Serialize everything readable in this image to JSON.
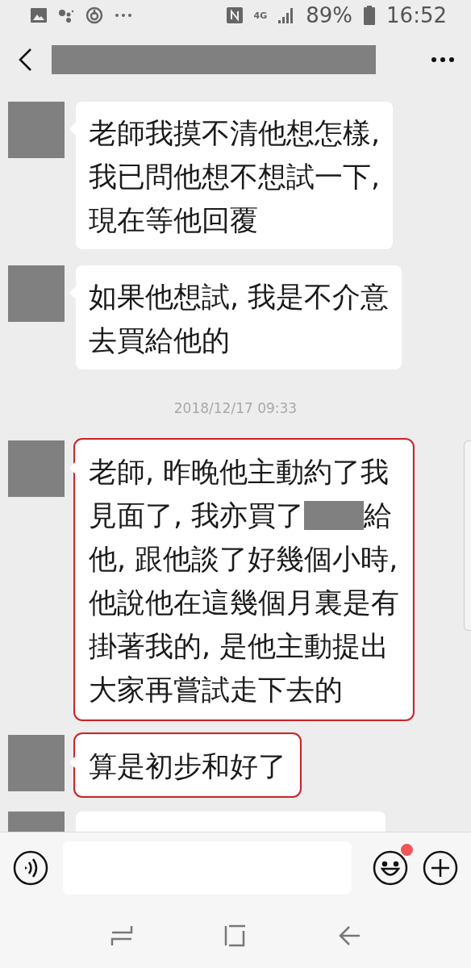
{
  "status_bar": {
    "network": "4G",
    "battery": "89%",
    "time": "16:52"
  },
  "chat": [
    {
      "kind": "message",
      "highlighted": false,
      "lines": [
        [
          {
            "kind": "text",
            "text": "老師我摸不清他想怎樣,"
          }
        ],
        [
          {
            "kind": "text",
            "text": "我已問他想不想試一下,"
          }
        ],
        [
          {
            "kind": "text",
            "text": "現在等他回覆"
          }
        ]
      ]
    },
    {
      "kind": "message",
      "highlighted": false,
      "lines": [
        [
          {
            "kind": "text",
            "text": "如果他想試, 我是不介意"
          }
        ],
        [
          {
            "kind": "text",
            "text": "去買給他的"
          }
        ]
      ]
    },
    {
      "kind": "time",
      "text": "2018/12/17 09:33"
    },
    {
      "kind": "message",
      "highlighted": true,
      "lines": [
        [
          {
            "kind": "text",
            "text": "老師, 昨晚他主動約了我"
          }
        ],
        [
          {
            "kind": "text",
            "text": "見面了, 我亦買了"
          },
          {
            "kind": "redacted"
          },
          {
            "kind": "text",
            "text": "給"
          }
        ],
        [
          {
            "kind": "text",
            "text": "他, 跟他談了好幾個小時,"
          }
        ],
        [
          {
            "kind": "text",
            "text": "他說他在這幾個月裏是有"
          }
        ],
        [
          {
            "kind": "text",
            "text": "掛著我的, 是他主動提出"
          }
        ],
        [
          {
            "kind": "text",
            "text": "大家再嘗試走下去的"
          }
        ]
      ]
    },
    {
      "kind": "message",
      "highlighted": true,
      "lines": [
        [
          {
            "kind": "text",
            "text": "算是初步和好了"
          }
        ]
      ]
    },
    {
      "kind": "message",
      "highlighted": false,
      "cut_off": true
    }
  ],
  "input_bar": {
    "emoji_badge": true
  }
}
